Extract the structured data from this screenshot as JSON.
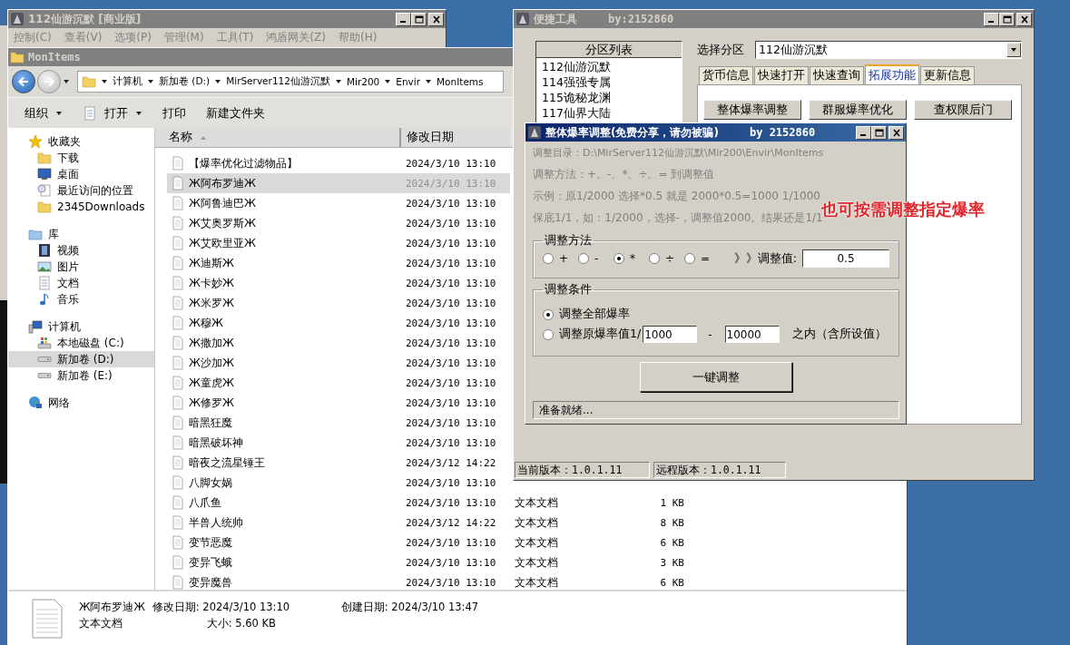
{
  "back_window": {
    "title": "112仙游沉默 [商业版]",
    "menu": [
      "控制(C)",
      "查看(V)",
      "选项(P)",
      "管理(M)",
      "工具(T)",
      "鸿盾网关(Z)",
      "帮助(H)"
    ]
  },
  "explorer": {
    "title": "MonItems",
    "address": [
      "计算机",
      "新加卷 (D:)",
      "MirServer112仙游沉默",
      "Mir200",
      "Envir",
      "MonItems"
    ],
    "toolbar": [
      {
        "label": "组织",
        "dropdown": true
      },
      {
        "label": "打开",
        "dropdown": true
      },
      {
        "label": "打印",
        "dropdown": false
      },
      {
        "label": "新建文件夹",
        "dropdown": false
      }
    ],
    "nav": [
      {
        "label": "收藏夹",
        "selected": false,
        "children": [
          {
            "label": "下载",
            "selected": false
          },
          {
            "label": "桌面",
            "selected": false
          },
          {
            "label": "最近访问的位置",
            "selected": false
          },
          {
            "label": "2345Downloads",
            "selected": false
          }
        ]
      },
      {
        "label": "库",
        "selected": false,
        "children": [
          {
            "label": "视频",
            "selected": false
          },
          {
            "label": "图片",
            "selected": false
          },
          {
            "label": "文档",
            "selected": false
          },
          {
            "label": "音乐",
            "selected": false
          }
        ]
      },
      {
        "label": "计算机",
        "selected": false,
        "children": [
          {
            "label": "本地磁盘 (C:)",
            "selected": false
          },
          {
            "label": "新加卷 (D:)",
            "selected": true
          },
          {
            "label": "新加卷 (E:)",
            "selected": false
          }
        ]
      },
      {
        "label": "网络",
        "selected": false
      }
    ],
    "columns": [
      "名称",
      "修改日期"
    ],
    "files": [
      {
        "name": "【爆率优化过滤物品】",
        "modified": "2024/3/10 13:10",
        "selected": false
      },
      {
        "name": "Ж阿布罗迪Ж",
        "modified": "2024/3/10 13:10",
        "selected": true
      },
      {
        "name": "Ж阿鲁迪巴Ж",
        "modified": "2024/3/10 13:10",
        "selected": false
      },
      {
        "name": "Ж艾奥罗斯Ж",
        "modified": "2024/3/10 13:10",
        "selected": false
      },
      {
        "name": "Ж艾欧里亚Ж",
        "modified": "2024/3/10 13:10",
        "selected": false
      },
      {
        "name": "Ж迪斯Ж",
        "modified": "2024/3/10 13:10",
        "selected": false
      },
      {
        "name": "Ж卡妙Ж",
        "modified": "2024/3/10 13:10",
        "selected": false
      },
      {
        "name": "Ж米罗Ж",
        "modified": "2024/3/10 13:10",
        "selected": false
      },
      {
        "name": "Ж穆Ж",
        "modified": "2024/3/10 13:10",
        "selected": false
      },
      {
        "name": "Ж撒加Ж",
        "modified": "2024/3/10 13:10",
        "selected": false
      },
      {
        "name": "Ж沙加Ж",
        "modified": "2024/3/10 13:10",
        "selected": false
      },
      {
        "name": "Ж童虎Ж",
        "modified": "2024/3/10 13:10",
        "selected": false
      },
      {
        "name": "Ж修罗Ж",
        "modified": "2024/3/10 13:10",
        "selected": false
      },
      {
        "name": "暗黑狂魔",
        "modified": "2024/3/10 13:10",
        "selected": false
      },
      {
        "name": "暗黑破坏神",
        "modified": "2024/3/10 13:10",
        "selected": false
      },
      {
        "name": "暗夜之流星锤王",
        "modified": "2024/3/12 14:22",
        "selected": false
      },
      {
        "name": "八脚女娲",
        "modified": "2024/3/10 13:10",
        "selected": false
      },
      {
        "name": "八爪鱼",
        "modified": "2024/3/10 13:10",
        "type": "文本文档",
        "size": "1 KB",
        "selected": false
      },
      {
        "name": "半兽人统帅",
        "modified": "2024/3/12 14:22",
        "type": "文本文档",
        "size": "8 KB",
        "selected": false
      },
      {
        "name": "变节恶魔",
        "modified": "2024/3/10 13:10",
        "type": "文本文档",
        "size": "6 KB",
        "selected": false
      },
      {
        "name": "变异飞蛾",
        "modified": "2024/3/10 13:10",
        "type": "文本文档",
        "size": "3 KB",
        "selected": false
      },
      {
        "name": "变异魔兽",
        "modified": "2024/3/10 13:10",
        "type": "文本文档",
        "size": "6 KB",
        "selected": false
      }
    ],
    "details": {
      "name": "Ж阿布罗迪Ж",
      "type": "文本文档",
      "modified": "修改日期: 2024/3/10 13:10",
      "size": "大小: 5.60 KB",
      "created": "创建日期: 2024/3/10 13:47"
    }
  },
  "tool_window": {
    "title": "便捷工具",
    "author": "by:2152860",
    "list_header": "分区列表",
    "servers": [
      "112仙游沉默",
      "114强强专属",
      "115诡秘龙渊",
      "117仙界大陆"
    ],
    "select_label": "选择分区",
    "select_value": "112仙游沉默",
    "tabs": [
      {
        "label": "货币信息",
        "selected": false
      },
      {
        "label": "快速打开",
        "selected": false
      },
      {
        "label": "快速查询",
        "selected": false
      },
      {
        "label": "拓展功能",
        "selected": true
      },
      {
        "label": "更新信息",
        "selected": false
      }
    ],
    "buttons": [
      "整体爆率调整",
      "群服爆率优化",
      "查权限后门"
    ],
    "status": [
      "当前版本：1.0.1.11",
      "远程版本：1.0.1.11"
    ]
  },
  "dialog": {
    "title": "整体爆率调整(免费分享，请勿被骗)",
    "author": "by 2152860",
    "info": [
      "调整目录：D:\\MirServer112仙游沉默\\Mir200\\Envir\\MonItems",
      "调整方法：+、-、*、÷、=   到调整值",
      "示例：原1/2000 选择*0.5 就是 2000*0.5=1000  1/1000",
      "保底1/1，如：1/2000，选择-，调整值2000。结果还是1/1"
    ],
    "method": {
      "title": "调整方法",
      "options": [
        {
          "label": "+",
          "selected": false
        },
        {
          "label": "-",
          "selected": false
        },
        {
          "label": "*",
          "selected": true
        },
        {
          "label": "÷",
          "selected": false
        },
        {
          "label": "=",
          "selected": false
        }
      ],
      "value_label": "》》调整值:",
      "value": "0.5"
    },
    "condition": {
      "title": "调整条件",
      "options": [
        {
          "label": "调整全部爆率",
          "selected": true
        },
        {
          "label": "调整原爆率值1/",
          "selected": false
        }
      ],
      "range_from": "1000",
      "range_separator": "-",
      "range_to": "10000",
      "range_suffix": "之内（含所设值）"
    },
    "button": "一键调整",
    "status": "准备就绪..."
  },
  "annotation": "也可按需调整指定爆率"
}
